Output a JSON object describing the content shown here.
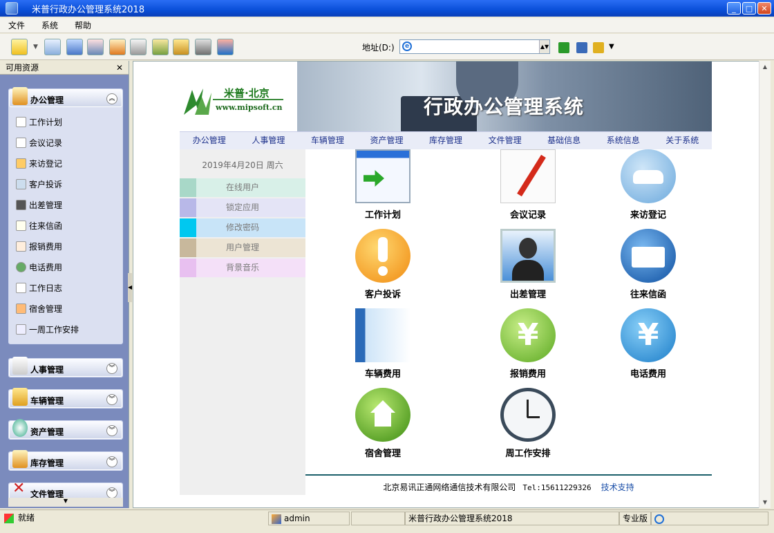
{
  "window": {
    "title": "米普行政办公管理系统2018"
  },
  "menu": [
    "文件",
    "系统",
    "帮助"
  ],
  "address": {
    "label": "地址(D:)",
    "value": ""
  },
  "sidebar": {
    "header": "可用资源",
    "close": "✕",
    "groups": [
      {
        "label": "办公管理",
        "expanded": true,
        "items": [
          "工作计划",
          "会议记录",
          "来访登记",
          "客户投诉",
          "出差管理",
          "往来信函",
          "报销费用",
          "电话费用",
          "工作日志",
          "宿舍管理",
          "一周工作安排"
        ]
      },
      {
        "label": "人事管理",
        "expanded": false
      },
      {
        "label": "车辆管理",
        "expanded": false
      },
      {
        "label": "资产管理",
        "expanded": false
      },
      {
        "label": "库存管理",
        "expanded": false
      },
      {
        "label": "文件管理",
        "expanded": false
      }
    ]
  },
  "banner": {
    "brand": "米普·北京",
    "url": "www.mipsoft.cn",
    "title": "行政办公管理系统"
  },
  "nav": [
    "办公管理",
    "人事管理",
    "车辆管理",
    "资产管理",
    "库存管理",
    "文件管理",
    "基础信息",
    "系统信息",
    "关于系统"
  ],
  "left_panel": {
    "date": "2019年4月20日  周六",
    "items": [
      {
        "label": "在线用户",
        "swatch": "#a8d8c8",
        "bg": "#d8f0e8"
      },
      {
        "label": "锁定应用",
        "swatch": "#b8b8e8",
        "bg": "#e4e4f6"
      },
      {
        "label": "修改密码",
        "swatch": "#00c8f0",
        "bg": "#c8e4f8"
      },
      {
        "label": "用户管理",
        "swatch": "#c8b89c",
        "bg": "#ece4d4"
      },
      {
        "label": "背景音乐",
        "swatch": "#e8c0f0",
        "bg": "#f4e0f8"
      }
    ]
  },
  "apps": [
    {
      "label": "工作计划",
      "icon": "calendar-icon"
    },
    {
      "label": "会议记录",
      "icon": "notepad-pen-icon"
    },
    {
      "label": "来访登记",
      "icon": "visitors-icon"
    },
    {
      "label": "客户投诉",
      "icon": "warning-icon"
    },
    {
      "label": "出差管理",
      "icon": "user-check-icon"
    },
    {
      "label": "往来信函",
      "icon": "envelope-icon"
    },
    {
      "label": "车辆费用",
      "icon": "folder-icon"
    },
    {
      "label": "报销费用",
      "icon": "yen-green-icon"
    },
    {
      "label": "电话费用",
      "icon": "yen-blue-icon"
    },
    {
      "label": "宿舍管理",
      "icon": "home-icon"
    },
    {
      "label": "周工作安排",
      "icon": "clock-icon"
    }
  ],
  "footer": {
    "company": "北京易讯正通网络通信技术有限公司",
    "tel": "Tel:15611229326",
    "support": "技术支持"
  },
  "status": {
    "ready": "就绪",
    "user": "admin",
    "app": "米普行政办公管理系统2018",
    "edition": "专业版"
  }
}
